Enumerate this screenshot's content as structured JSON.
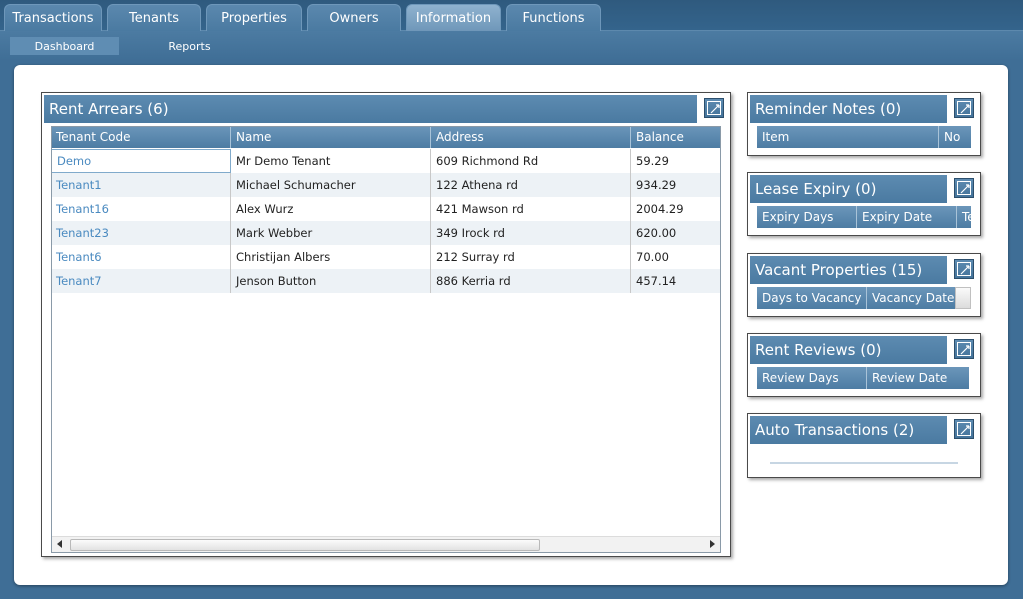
{
  "nav": {
    "tabs": [
      {
        "label": "Transactions"
      },
      {
        "label": "Tenants"
      },
      {
        "label": "Properties"
      },
      {
        "label": "Owners"
      },
      {
        "label": "Information"
      },
      {
        "label": "Functions"
      }
    ],
    "active_tab": "Information",
    "subtabs": [
      {
        "label": "Dashboard"
      },
      {
        "label": "Reports"
      }
    ],
    "active_subtab": "Dashboard"
  },
  "rent_arrears": {
    "title": "Rent Arrears (6)",
    "columns": [
      "Tenant Code",
      "Name",
      "Address",
      "Balance"
    ],
    "rows": [
      {
        "code": "Demo",
        "name": "Mr Demo Tenant",
        "address": "609 Richmond Rd",
        "balance": "59.29"
      },
      {
        "code": "Tenant1",
        "name": "Michael Schumacher",
        "address": "122 Athena rd",
        "balance": "934.29"
      },
      {
        "code": "Tenant16",
        "name": "Alex Wurz",
        "address": "421 Mawson rd",
        "balance": "2004.29"
      },
      {
        "code": "Tenant23",
        "name": "Mark Webber",
        "address": "349 Irock rd",
        "balance": "620.00"
      },
      {
        "code": "Tenant6",
        "name": "Christijan Albers",
        "address": "212 Surray rd",
        "balance": "70.00"
      },
      {
        "code": "Tenant7",
        "name": "Jenson Button",
        "address": "886 Kerria rd",
        "balance": "457.14"
      }
    ]
  },
  "reminder_notes": {
    "title": "Reminder Notes (0)",
    "columns": [
      "Item",
      "No"
    ]
  },
  "lease_expiry": {
    "title": "Lease Expiry (0)",
    "columns": [
      "Expiry Days",
      "Expiry Date",
      "Te"
    ]
  },
  "vacant_properties": {
    "title": "Vacant Properties (15)",
    "columns": [
      "Days to Vacancy",
      "Vacancy Date"
    ]
  },
  "rent_reviews": {
    "title": "Rent Reviews (0)",
    "columns": [
      "Review Days",
      "Review Date"
    ]
  },
  "auto_transactions": {
    "title": "Auto Transactions (2)"
  },
  "colors": {
    "background": "#3f6e96",
    "header": "#4a7aa1",
    "link": "#4a8ac0"
  }
}
